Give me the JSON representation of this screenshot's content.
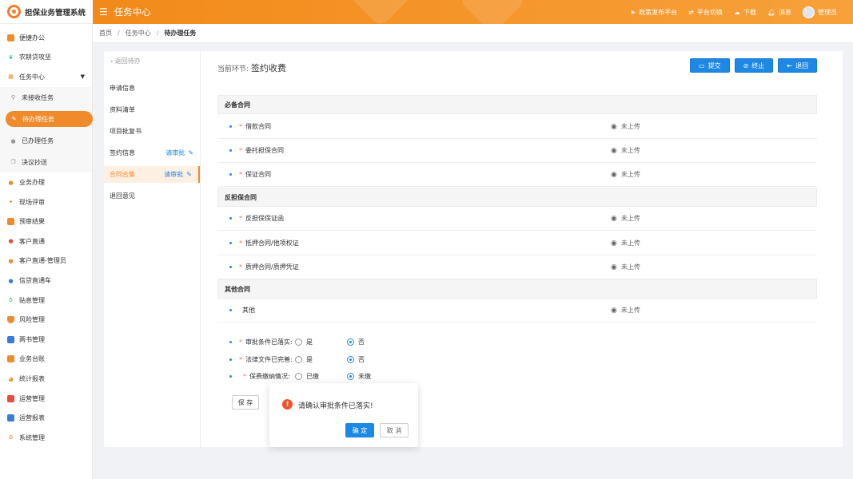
{
  "app": {
    "name": "担保业务管理系统"
  },
  "header": {
    "title": "任务中心",
    "items": [
      {
        "label": "政策发布平台",
        "icon": "send-icon"
      },
      {
        "label": "平台切换",
        "icon": "switch-icon"
      },
      {
        "label": "下载",
        "icon": "cloud-download-icon"
      },
      {
        "label": "消息",
        "icon": "bell-icon"
      },
      {
        "label": "管理员",
        "icon": "avatar"
      }
    ]
  },
  "sidebar": {
    "items": [
      {
        "label": "便捷办公",
        "icon": "briefcase-icon",
        "color": "#f08b2c"
      },
      {
        "label": "农耕贷攻坚",
        "icon": "leaf-icon",
        "color": "#1abc9c"
      },
      {
        "label": "任务中心",
        "icon": "grid-icon",
        "color": "#f08b2c"
      },
      {
        "label": "未接收任务",
        "icon": "plug-icon",
        "color": "#888888"
      },
      {
        "label": "待办理任务",
        "icon": "edit-icon",
        "color": "#ffffff"
      },
      {
        "label": "已办理任务",
        "icon": "circle-icon",
        "color": "#999999"
      },
      {
        "label": "决议抄送",
        "icon": "copy-icon",
        "color": "#888888"
      },
      {
        "label": "业务办理",
        "icon": "user-icon",
        "color": "#f08b2c"
      },
      {
        "label": "现场评审",
        "icon": "review-icon",
        "color": "#f08b2c"
      },
      {
        "label": "预审结果",
        "icon": "result-icon",
        "color": "#f08b2c"
      },
      {
        "label": "客户直通",
        "icon": "person-icon",
        "color": "#e74c3c"
      },
      {
        "label": "客户直通-管理员",
        "icon": "person-icon",
        "color": "#f08b2c"
      },
      {
        "label": "信贷直通车",
        "icon": "person-icon",
        "color": "#3a7bd5"
      },
      {
        "label": "贴息管理",
        "icon": "money-bag-icon",
        "color": "#27ae60"
      },
      {
        "label": "风险管理",
        "icon": "shield-icon",
        "color": "#f08b2c"
      },
      {
        "label": "两书管理",
        "icon": "chart-icon",
        "color": "#3a7bd5"
      },
      {
        "label": "业务台账",
        "icon": "ledger-icon",
        "color": "#f08b2c"
      },
      {
        "label": "统计报表",
        "icon": "pie-icon",
        "color": "#f08b2c"
      },
      {
        "label": "运营管理",
        "icon": "ops-icon",
        "color": "#e74c3c"
      },
      {
        "label": "运营报表",
        "icon": "report-icon",
        "color": "#3a7bd5"
      },
      {
        "label": "系统管理",
        "icon": "gear-icon",
        "color": "#f08b2c"
      }
    ]
  },
  "breadcrumb": [
    "首页",
    "任务中心",
    "待办理任务"
  ],
  "steps": {
    "back_label": "返回待办",
    "items": [
      {
        "label": "申请信息",
        "badge": ""
      },
      {
        "label": "资料清单",
        "badge": ""
      },
      {
        "label": "项目批复书",
        "badge": ""
      },
      {
        "label": "签约信息",
        "badge": "请审批"
      },
      {
        "label": "合同合集",
        "badge": "请审批"
      },
      {
        "label": "退回意见",
        "badge": ""
      }
    ]
  },
  "main": {
    "stage_label": "当前环节:",
    "stage_value": "签约收费",
    "actions": [
      {
        "label": "提交",
        "icon": "comment-icon"
      },
      {
        "label": "终止",
        "icon": "ban-icon"
      },
      {
        "label": "退回",
        "icon": "return-icon"
      }
    ],
    "sections": [
      {
        "title": "必备合同",
        "docs": [
          {
            "name": "借款合同",
            "required": "*",
            "status": "未上传"
          },
          {
            "name": "委托担保合同",
            "required": "*",
            "status": "未上传"
          },
          {
            "name": "保证合同",
            "required": "*",
            "status": "未上传"
          }
        ]
      },
      {
        "title": "反担保合同",
        "docs": [
          {
            "name": "反担保保证函",
            "required": "*",
            "status": "未上传"
          },
          {
            "name": "抵押合同/他项权证",
            "required": "*",
            "status": "未上传"
          },
          {
            "name": "质押合同/质押凭证",
            "required": "*",
            "status": "未上传"
          }
        ]
      },
      {
        "title": "其他合同",
        "docs": [
          {
            "name": "其他",
            "required": "",
            "status": "未上传"
          }
        ]
      }
    ],
    "conditions": [
      {
        "label": "审批条件已落实:",
        "opt1": "是",
        "opt2": "否",
        "selected": "否"
      },
      {
        "label": "法律文件已完善:",
        "opt1": "是",
        "opt2": "否",
        "selected": "否"
      },
      {
        "label": "保费缴纳情况:",
        "opt1": "已缴",
        "opt2": "未缴",
        "selected": "未缴"
      }
    ],
    "save_label": "保 存"
  },
  "popup": {
    "message": "请确认审批条件已落实!",
    "ok_label": "确 定",
    "cancel_label": "取 消"
  }
}
